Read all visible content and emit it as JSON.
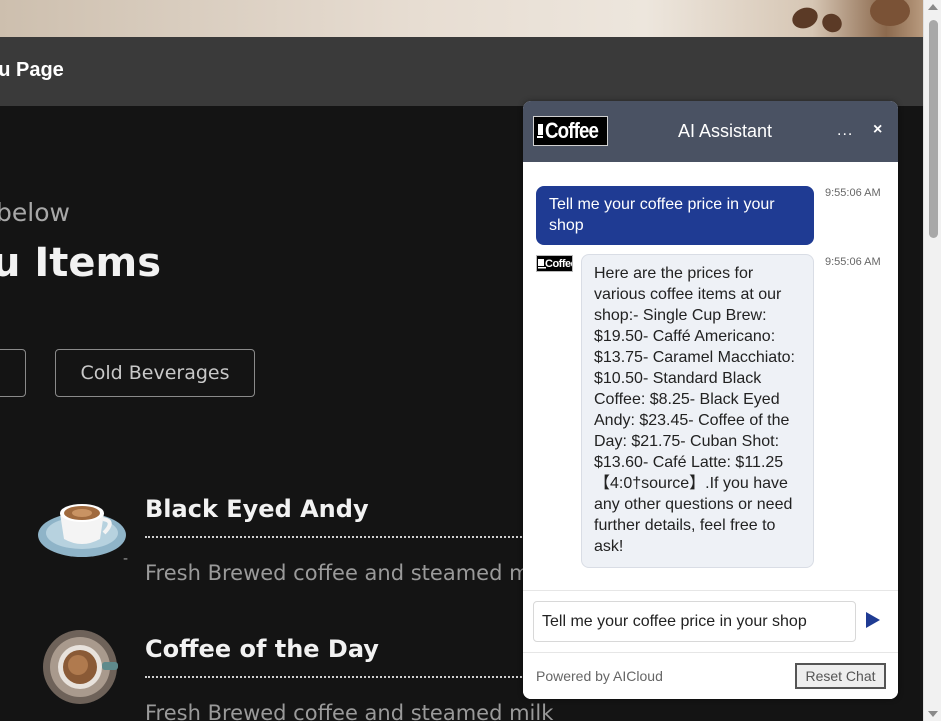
{
  "page": {
    "topbar_title": "nu Page",
    "subtitle": "below",
    "section_title": "u Items",
    "categories": [
      {
        "label": ""
      },
      {
        "label": "Cold Beverages"
      }
    ],
    "menu_items": [
      {
        "name": "Black Eyed Andy",
        "description": "Fresh Brewed coffee and steamed m",
        "dash": "-"
      },
      {
        "name": "Coffee of the Day",
        "description": "Fresh Brewed coffee and steamed milk"
      }
    ]
  },
  "chat": {
    "logo_text": "Coffee",
    "title": "AI Assistant",
    "more_label": "...",
    "close_label": "×",
    "messages": [
      {
        "role": "user",
        "text": "Tell me your coffee price in your shop",
        "time": "9:55:06 AM"
      },
      {
        "role": "bot",
        "avatar_text": "Coffee",
        "text": "Here are the prices for various coffee items at our shop:- Single Cup Brew: $19.50- Caffé Americano: $13.75- Caramel Macchiato: $10.50- Standard Black Coffee: $8.25- Black Eyed Andy: $23.45- Coffee of the Day: $21.75- Cuban Shot: $13.60- Café Latte: $11.25 【4:0†source】.If you have any other questions or need further details, feel free to ask!",
        "time": "9:55:06 AM"
      }
    ],
    "input_value": "Tell me your coffee price in your shop",
    "powered_by": "Powered by AICloud",
    "reset_label": "Reset Chat"
  },
  "colors": {
    "header": "#4a5263",
    "user_bubble": "#1f3b93",
    "bot_bubble": "#eef1f6",
    "page_bg": "#141414",
    "topbar": "#3a3a3a"
  }
}
